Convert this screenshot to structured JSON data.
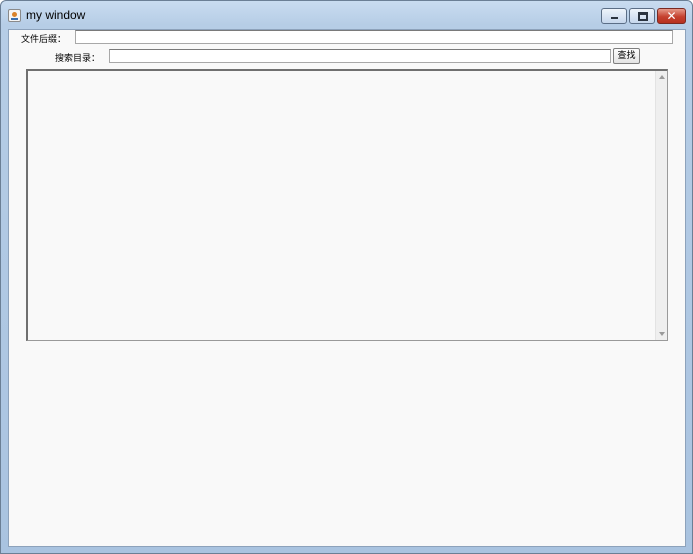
{
  "window": {
    "title": "my window",
    "icon": "java-cup-icon",
    "controls": [
      "minimize",
      "maximize",
      "close"
    ],
    "close_glyph": "✕"
  },
  "form": {
    "suffix_label": "文件后缀：",
    "suffix_value": "",
    "dir_label": "搜索目录：",
    "dir_value": "",
    "search_button": "查找"
  },
  "results": {
    "text": ""
  },
  "colors": {
    "titlebar": "#b6cde6",
    "client_bg": "#f9f9f9",
    "close_button": "#c5412f"
  }
}
